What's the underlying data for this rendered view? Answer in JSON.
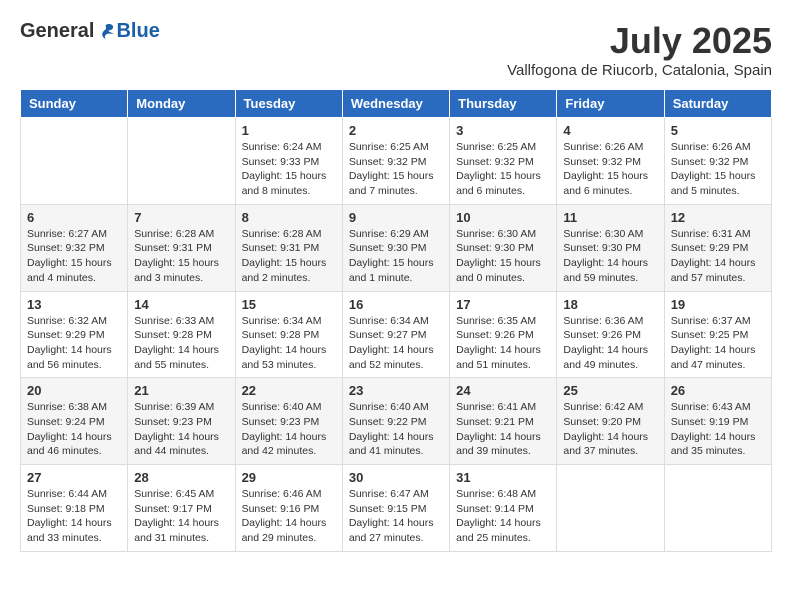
{
  "logo": {
    "general": "General",
    "blue": "Blue"
  },
  "header": {
    "month": "July 2025",
    "location": "Vallfogona de Riucorb, Catalonia, Spain"
  },
  "days_of_week": [
    "Sunday",
    "Monday",
    "Tuesday",
    "Wednesday",
    "Thursday",
    "Friday",
    "Saturday"
  ],
  "weeks": [
    [
      {
        "day": "",
        "info": ""
      },
      {
        "day": "",
        "info": ""
      },
      {
        "day": "1",
        "info": "Sunrise: 6:24 AM\nSunset: 9:33 PM\nDaylight: 15 hours and 8 minutes."
      },
      {
        "day": "2",
        "info": "Sunrise: 6:25 AM\nSunset: 9:32 PM\nDaylight: 15 hours and 7 minutes."
      },
      {
        "day": "3",
        "info": "Sunrise: 6:25 AM\nSunset: 9:32 PM\nDaylight: 15 hours and 6 minutes."
      },
      {
        "day": "4",
        "info": "Sunrise: 6:26 AM\nSunset: 9:32 PM\nDaylight: 15 hours and 6 minutes."
      },
      {
        "day": "5",
        "info": "Sunrise: 6:26 AM\nSunset: 9:32 PM\nDaylight: 15 hours and 5 minutes."
      }
    ],
    [
      {
        "day": "6",
        "info": "Sunrise: 6:27 AM\nSunset: 9:32 PM\nDaylight: 15 hours and 4 minutes."
      },
      {
        "day": "7",
        "info": "Sunrise: 6:28 AM\nSunset: 9:31 PM\nDaylight: 15 hours and 3 minutes."
      },
      {
        "day": "8",
        "info": "Sunrise: 6:28 AM\nSunset: 9:31 PM\nDaylight: 15 hours and 2 minutes."
      },
      {
        "day": "9",
        "info": "Sunrise: 6:29 AM\nSunset: 9:30 PM\nDaylight: 15 hours and 1 minute."
      },
      {
        "day": "10",
        "info": "Sunrise: 6:30 AM\nSunset: 9:30 PM\nDaylight: 15 hours and 0 minutes."
      },
      {
        "day": "11",
        "info": "Sunrise: 6:30 AM\nSunset: 9:30 PM\nDaylight: 14 hours and 59 minutes."
      },
      {
        "day": "12",
        "info": "Sunrise: 6:31 AM\nSunset: 9:29 PM\nDaylight: 14 hours and 57 minutes."
      }
    ],
    [
      {
        "day": "13",
        "info": "Sunrise: 6:32 AM\nSunset: 9:29 PM\nDaylight: 14 hours and 56 minutes."
      },
      {
        "day": "14",
        "info": "Sunrise: 6:33 AM\nSunset: 9:28 PM\nDaylight: 14 hours and 55 minutes."
      },
      {
        "day": "15",
        "info": "Sunrise: 6:34 AM\nSunset: 9:28 PM\nDaylight: 14 hours and 53 minutes."
      },
      {
        "day": "16",
        "info": "Sunrise: 6:34 AM\nSunset: 9:27 PM\nDaylight: 14 hours and 52 minutes."
      },
      {
        "day": "17",
        "info": "Sunrise: 6:35 AM\nSunset: 9:26 PM\nDaylight: 14 hours and 51 minutes."
      },
      {
        "day": "18",
        "info": "Sunrise: 6:36 AM\nSunset: 9:26 PM\nDaylight: 14 hours and 49 minutes."
      },
      {
        "day": "19",
        "info": "Sunrise: 6:37 AM\nSunset: 9:25 PM\nDaylight: 14 hours and 47 minutes."
      }
    ],
    [
      {
        "day": "20",
        "info": "Sunrise: 6:38 AM\nSunset: 9:24 PM\nDaylight: 14 hours and 46 minutes."
      },
      {
        "day": "21",
        "info": "Sunrise: 6:39 AM\nSunset: 9:23 PM\nDaylight: 14 hours and 44 minutes."
      },
      {
        "day": "22",
        "info": "Sunrise: 6:40 AM\nSunset: 9:23 PM\nDaylight: 14 hours and 42 minutes."
      },
      {
        "day": "23",
        "info": "Sunrise: 6:40 AM\nSunset: 9:22 PM\nDaylight: 14 hours and 41 minutes."
      },
      {
        "day": "24",
        "info": "Sunrise: 6:41 AM\nSunset: 9:21 PM\nDaylight: 14 hours and 39 minutes."
      },
      {
        "day": "25",
        "info": "Sunrise: 6:42 AM\nSunset: 9:20 PM\nDaylight: 14 hours and 37 minutes."
      },
      {
        "day": "26",
        "info": "Sunrise: 6:43 AM\nSunset: 9:19 PM\nDaylight: 14 hours and 35 minutes."
      }
    ],
    [
      {
        "day": "27",
        "info": "Sunrise: 6:44 AM\nSunset: 9:18 PM\nDaylight: 14 hours and 33 minutes."
      },
      {
        "day": "28",
        "info": "Sunrise: 6:45 AM\nSunset: 9:17 PM\nDaylight: 14 hours and 31 minutes."
      },
      {
        "day": "29",
        "info": "Sunrise: 6:46 AM\nSunset: 9:16 PM\nDaylight: 14 hours and 29 minutes."
      },
      {
        "day": "30",
        "info": "Sunrise: 6:47 AM\nSunset: 9:15 PM\nDaylight: 14 hours and 27 minutes."
      },
      {
        "day": "31",
        "info": "Sunrise: 6:48 AM\nSunset: 9:14 PM\nDaylight: 14 hours and 25 minutes."
      },
      {
        "day": "",
        "info": ""
      },
      {
        "day": "",
        "info": ""
      }
    ]
  ]
}
